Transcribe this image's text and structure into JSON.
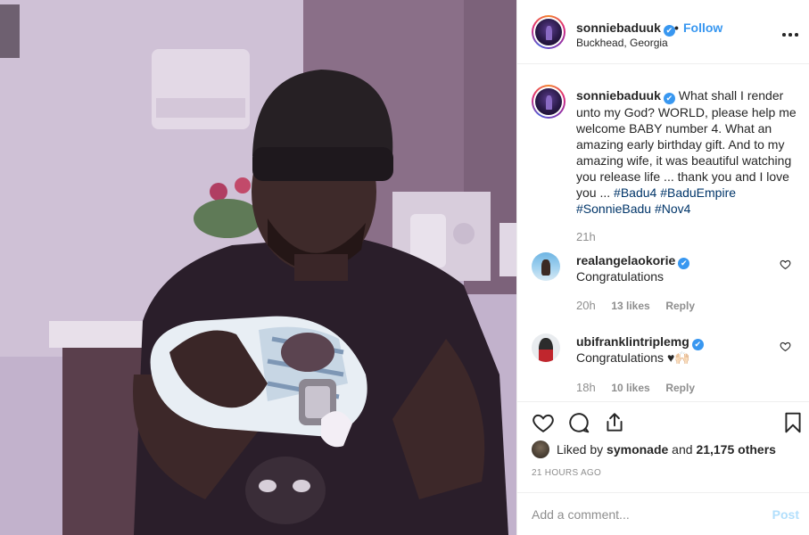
{
  "post": {
    "username": "sonniebaduuk",
    "verified": "✔",
    "follow_dot": "•",
    "follow_label": "Follow",
    "location": "Buckhead, Georgia",
    "more_icon": "more-horizontal-icon",
    "photo_description_icon": "photo"
  },
  "caption": {
    "username": "sonniebaduuk",
    "text": "What shall I render unto my God? WORLD, please help me welcome BABY number 4. What an amazing early birthday gift. And to my amazing wife, it was beautiful watching you release life ... thank you and I love you ...",
    "hashtags": [
      "#Badu4",
      "#BaduEmpire",
      "#SonnieBadu",
      "#Nov4"
    ],
    "time": "21h"
  },
  "comments": [
    {
      "username": "realangelaokorie",
      "text": "Congratulations",
      "time": "20h",
      "likes": "13 likes",
      "reply": "Reply"
    },
    {
      "username": "ubifranklintriplemg",
      "text": "Congratulations ♥🙌🏻",
      "time": "18h",
      "likes": "10 likes",
      "reply": "Reply"
    }
  ],
  "actions": {
    "like_icon": "heart-icon",
    "comment_icon": "comment-icon",
    "share_icon": "share-icon",
    "save_icon": "bookmark-icon"
  },
  "likes": {
    "prefix": "Liked by ",
    "user": "symonade",
    "middle": " and ",
    "others": "21,175 others"
  },
  "timestamp": "21 HOURS AGO",
  "add_comment": {
    "placeholder": "Add a comment...",
    "post_label": "Post"
  },
  "colors": {
    "accent": "#3897f0",
    "hashtag": "#003569",
    "muted": "#8e8e8e",
    "post_disabled": "#b2dffc"
  }
}
